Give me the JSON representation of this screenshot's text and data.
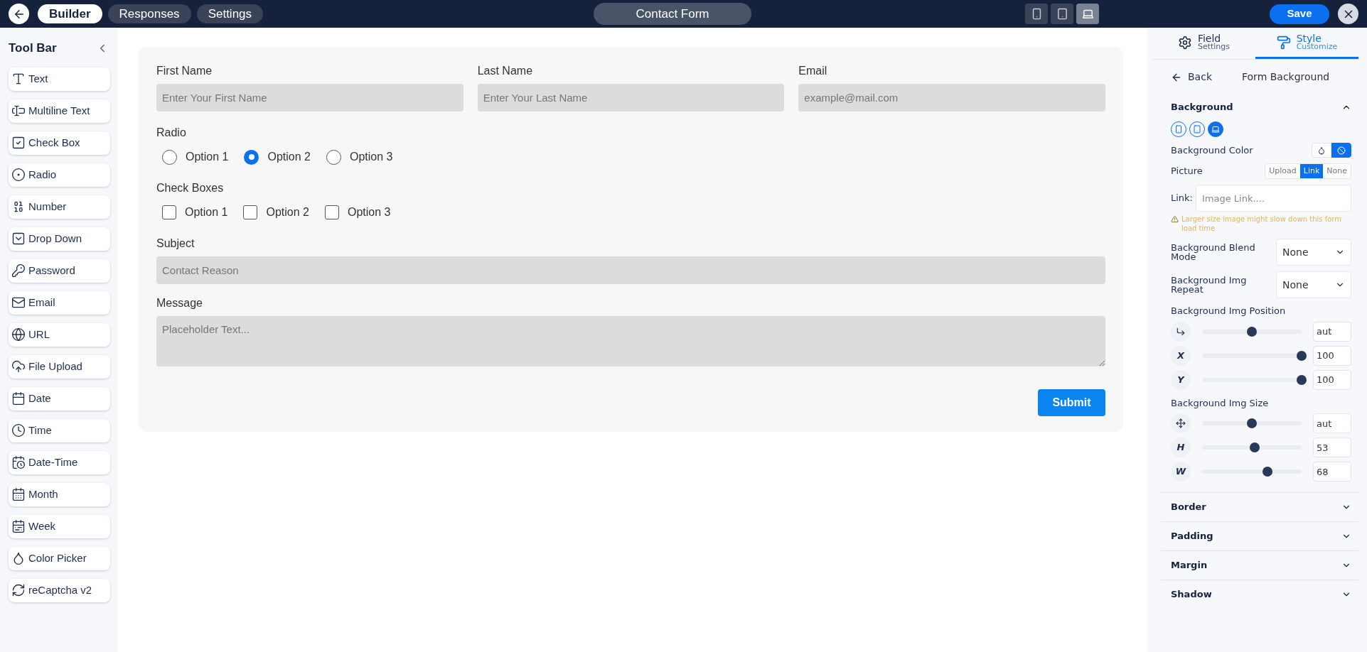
{
  "top_bar": {
    "tabs": [
      {
        "label": "Builder",
        "selected": true
      },
      {
        "label": "Responses",
        "selected": false
      },
      {
        "label": "Settings",
        "selected": false
      }
    ],
    "form_title": "Contact Form",
    "devices": [
      {
        "kind": "mobile",
        "selected": false
      },
      {
        "kind": "tablet",
        "selected": false
      },
      {
        "kind": "desktop",
        "selected": true
      }
    ],
    "save_label": "Save"
  },
  "tool_bar": {
    "title": "Tool Bar",
    "items": [
      {
        "kind": "text",
        "label": "Text"
      },
      {
        "kind": "multiline",
        "label": "Multiline Text"
      },
      {
        "kind": "checkbox",
        "label": "Check Box"
      },
      {
        "kind": "radio",
        "label": "Radio"
      },
      {
        "kind": "number",
        "label": "Number"
      },
      {
        "kind": "dropdown",
        "label": "Drop Down"
      },
      {
        "kind": "password",
        "label": "Password"
      },
      {
        "kind": "email",
        "label": "Email"
      },
      {
        "kind": "url",
        "label": "URL"
      },
      {
        "kind": "upload",
        "label": "File Upload"
      },
      {
        "kind": "date",
        "label": "Date"
      },
      {
        "kind": "time",
        "label": "Time"
      },
      {
        "kind": "datetime",
        "label": "Date-Time"
      },
      {
        "kind": "month",
        "label": "Month"
      },
      {
        "kind": "week",
        "label": "Week"
      },
      {
        "kind": "color",
        "label": "Color Picker"
      },
      {
        "kind": "captcha",
        "label": "reCaptcha v2"
      }
    ]
  },
  "form": {
    "row_fields": [
      {
        "label": "First Name",
        "placeholder": "Enter Your First Name"
      },
      {
        "label": "Last Name",
        "placeholder": "Enter Your Last Name"
      },
      {
        "label": "Email",
        "placeholder": "example@mail.com"
      }
    ],
    "radio": {
      "label": "Radio",
      "options": [
        {
          "label": "Option 1",
          "selected": false
        },
        {
          "label": "Option 2",
          "selected": true
        },
        {
          "label": "Option 3",
          "selected": false
        }
      ]
    },
    "check_boxes": {
      "label": "Check Boxes",
      "options": [
        {
          "label": "Option 1",
          "checked": false
        },
        {
          "label": "Option 2",
          "checked": false
        },
        {
          "label": "Option 3",
          "checked": false
        }
      ]
    },
    "subject": {
      "label": "Subject",
      "placeholder": "Contact Reason"
    },
    "message": {
      "label": "Message",
      "placeholder": "Placeholder Text..."
    },
    "submit_label": "Submit"
  },
  "style_panel": {
    "tabs": [
      {
        "kind": "settings",
        "title": "Field",
        "subtitle": "Settings",
        "selected": false
      },
      {
        "kind": "style",
        "title": "Style",
        "subtitle": "Customize",
        "selected": true
      }
    ],
    "back_label": "Back",
    "heading": "Form Background",
    "sections": [
      {
        "title": "Background",
        "expanded": true
      },
      {
        "title": "Border",
        "expanded": false
      },
      {
        "title": "Padding",
        "expanded": false
      },
      {
        "title": "Margin",
        "expanded": false
      },
      {
        "title": "Shadow",
        "expanded": false
      }
    ],
    "background": {
      "devices": [
        {
          "kind": "mobile",
          "selected": false
        },
        {
          "kind": "tablet",
          "selected": false
        },
        {
          "kind": "desktop",
          "selected": true
        }
      ],
      "color_label": "Background Color",
      "color_modes": [
        {
          "kind": "fill",
          "selected": false
        },
        {
          "kind": "none",
          "selected": true
        }
      ],
      "picture_label": "Picture",
      "picture_options": [
        {
          "label": "Upload",
          "selected": false
        },
        {
          "label": "Link",
          "selected": true
        },
        {
          "label": "None",
          "selected": false
        }
      ],
      "link_label": "Link:",
      "link_placeholder": "Image Link....",
      "warning": "Larger size image might slow down this form load time",
      "selects": [
        {
          "label": "Background Blend Mode",
          "value": "None"
        },
        {
          "label": "Background Img Repeat",
          "value": "None"
        }
      ],
      "position_label": "Background Img Position",
      "position": [
        {
          "kind": "corner",
          "level": 0.5,
          "value": "aut"
        },
        {
          "kind": "text",
          "symbol": "X",
          "level": 1,
          "value": "100"
        },
        {
          "kind": "text",
          "symbol": "Y",
          "level": 1,
          "value": "100"
        }
      ],
      "size_label": "Background Img Size",
      "size": [
        {
          "kind": "move",
          "level": 0.5,
          "value": "aut"
        },
        {
          "kind": "text",
          "symbol": "H",
          "level": 0.53,
          "value": "53"
        },
        {
          "kind": "text",
          "symbol": "W",
          "level": 0.66,
          "value": "68"
        }
      ]
    }
  }
}
